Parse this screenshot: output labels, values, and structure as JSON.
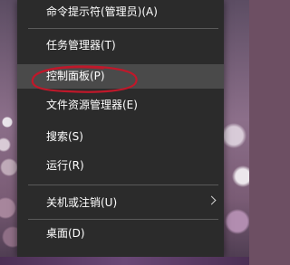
{
  "menu": {
    "items": [
      {
        "label": "命令提示符(管理员)(A)"
      },
      {
        "label": "任务管理器(T)"
      },
      {
        "label": "控制面板(P)"
      },
      {
        "label": "文件资源管理器(E)"
      },
      {
        "label": "搜索(S)"
      },
      {
        "label": "运行(R)"
      },
      {
        "label": "关机或注销(U)",
        "submenu_icon": "chevron-right-icon"
      },
      {
        "label": "桌面(D)"
      }
    ],
    "highlighted_item": "控制面板(P)",
    "annotation": "red-circle-around-control-panel"
  },
  "colors": {
    "menu_background": "#2b2b2b",
    "highlight": "#4a4a4a",
    "text": "#ffffff",
    "annotation": "#c0182a"
  }
}
